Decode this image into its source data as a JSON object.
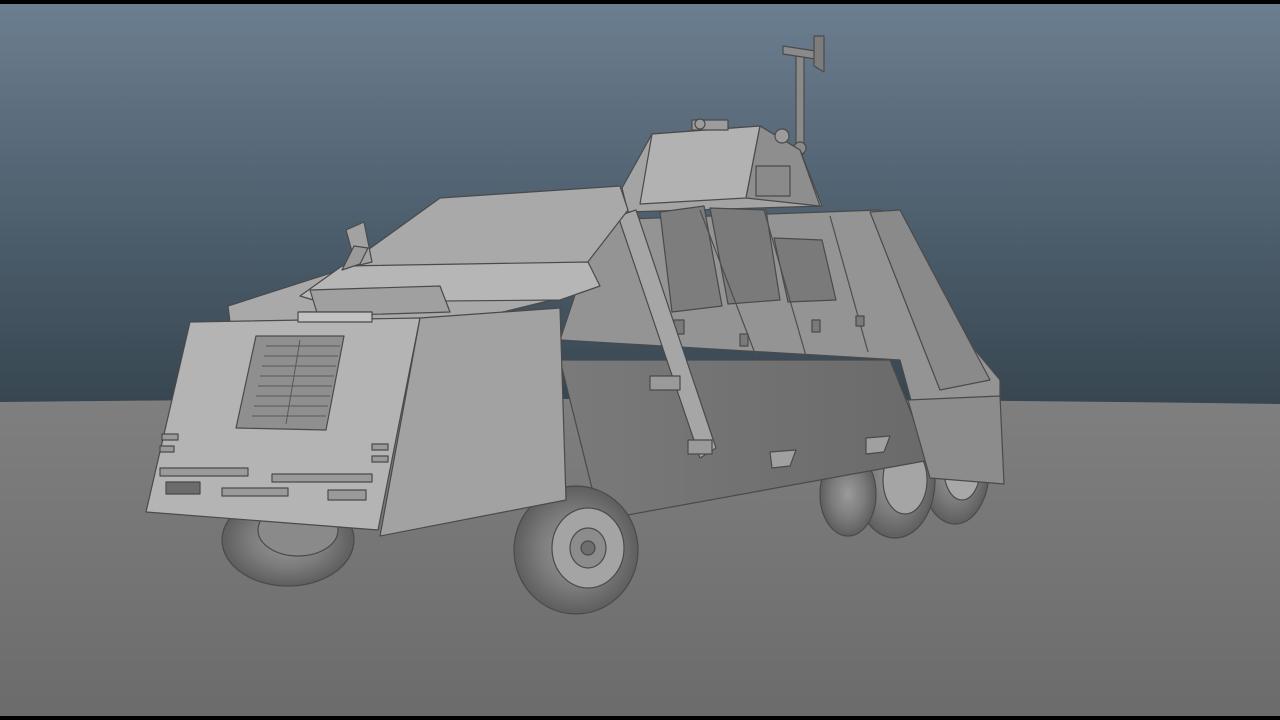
{
  "viewport": {
    "background_top_color": "#6a7d8e",
    "background_horizon_color": "#3a4a58",
    "ground_color": "#767676",
    "model_color": "#8c8c8c"
  },
  "model": {
    "plate_text": ""
  }
}
